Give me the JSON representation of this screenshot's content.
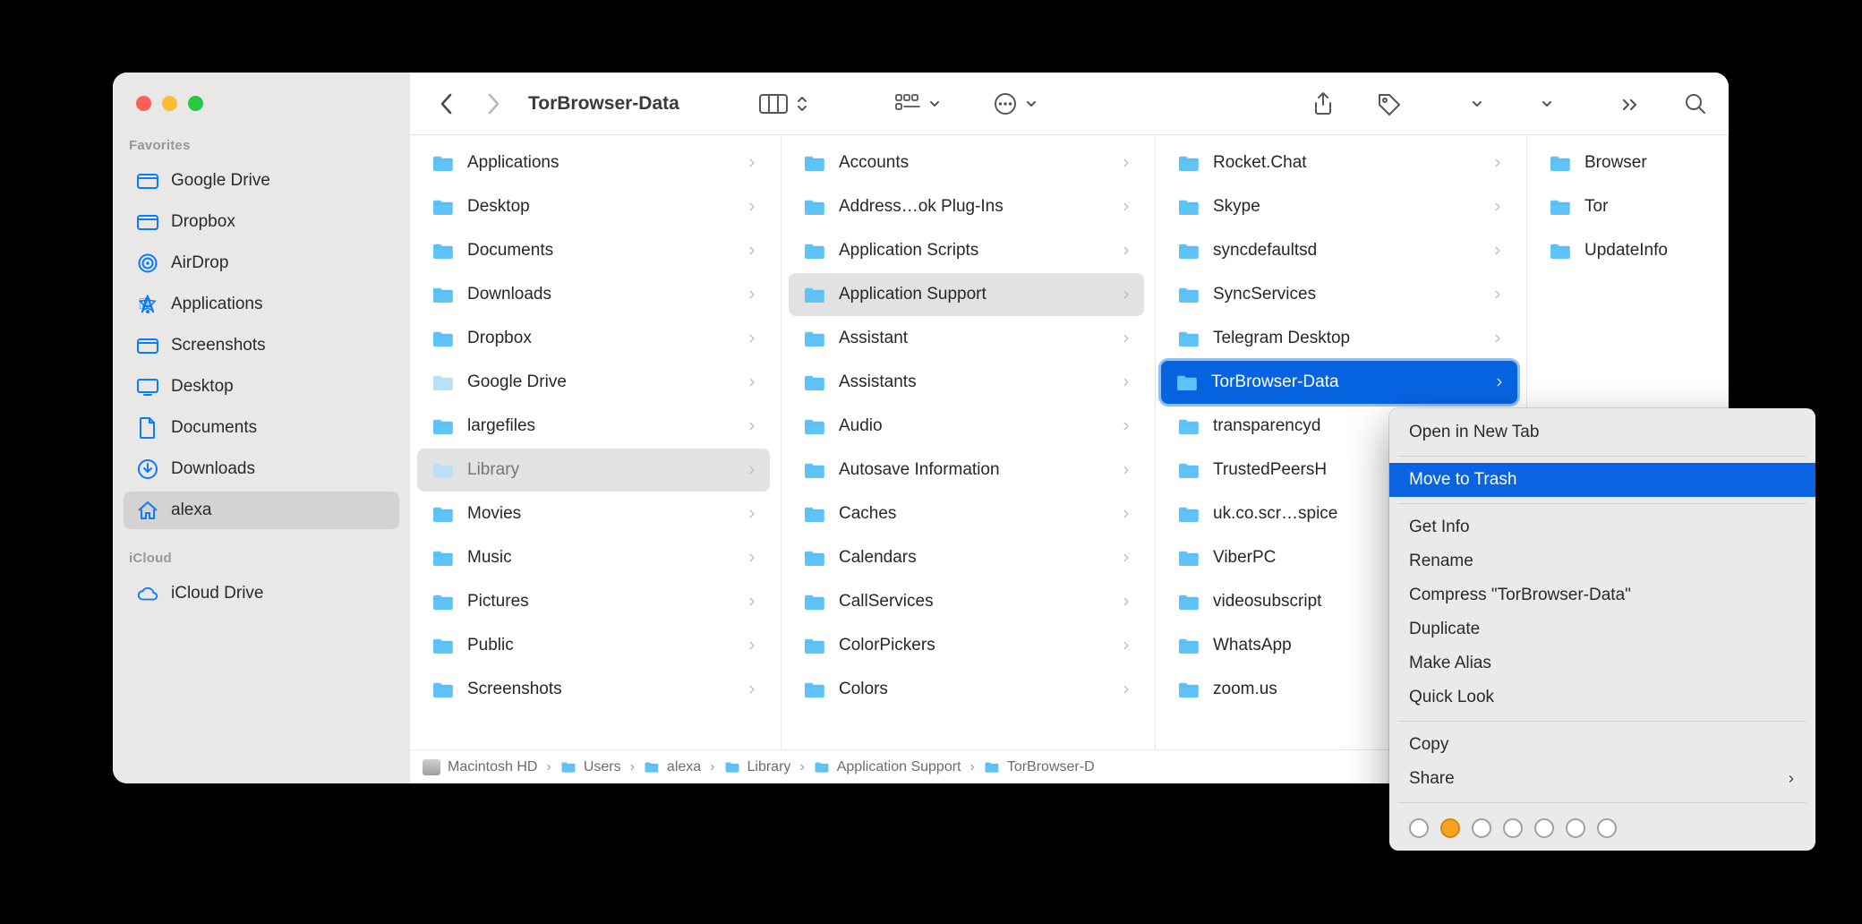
{
  "window_title": "TorBrowser-Data",
  "sidebar": {
    "sections": [
      {
        "heading": "Favorites",
        "items": [
          {
            "icon": "folder",
            "label": "Google Drive"
          },
          {
            "icon": "folder",
            "label": "Dropbox"
          },
          {
            "icon": "airdrop",
            "label": "AirDrop"
          },
          {
            "icon": "apps",
            "label": "Applications"
          },
          {
            "icon": "folder",
            "label": "Screenshots"
          },
          {
            "icon": "desktop",
            "label": "Desktop"
          },
          {
            "icon": "document",
            "label": "Documents"
          },
          {
            "icon": "download",
            "label": "Downloads"
          },
          {
            "icon": "home",
            "label": "alexa",
            "active": true
          }
        ]
      },
      {
        "heading": "iCloud",
        "items": [
          {
            "icon": "cloud",
            "label": "iCloud Drive"
          }
        ]
      }
    ]
  },
  "columns": [
    {
      "items": [
        {
          "name": "Applications",
          "chev": true
        },
        {
          "name": "Desktop",
          "chev": true
        },
        {
          "name": "Documents",
          "chev": true
        },
        {
          "name": "Downloads",
          "chev": true
        },
        {
          "name": "Dropbox",
          "chev": true
        },
        {
          "name": "Google Drive",
          "chev": true,
          "tint": "light"
        },
        {
          "name": "largefiles",
          "chev": true
        },
        {
          "name": "Library",
          "chev": true,
          "sel": "gray",
          "tint": "dim"
        },
        {
          "name": "Movies",
          "chev": true
        },
        {
          "name": "Music",
          "chev": true
        },
        {
          "name": "Pictures",
          "chev": true
        },
        {
          "name": "Public",
          "chev": true
        },
        {
          "name": "Screenshots",
          "chev": true
        }
      ]
    },
    {
      "items": [
        {
          "name": "Accounts",
          "chev": true
        },
        {
          "name": "Address…ok Plug-Ins",
          "chev": true
        },
        {
          "name": "Application Scripts",
          "chev": true
        },
        {
          "name": "Application Support",
          "chev": true,
          "sel": "gray2"
        },
        {
          "name": "Assistant",
          "chev": true
        },
        {
          "name": "Assistants",
          "chev": true
        },
        {
          "name": "Audio",
          "chev": true
        },
        {
          "name": "Autosave Information",
          "chev": true
        },
        {
          "name": "Caches",
          "chev": true
        },
        {
          "name": "Calendars",
          "chev": true
        },
        {
          "name": "CallServices",
          "chev": true
        },
        {
          "name": "ColorPickers",
          "chev": true
        },
        {
          "name": "Colors",
          "chev": true
        }
      ]
    },
    {
      "items": [
        {
          "name": "Rocket.Chat",
          "chev": true
        },
        {
          "name": "Skype",
          "chev": true
        },
        {
          "name": "syncdefaultsd",
          "chev": true
        },
        {
          "name": "SyncServices",
          "chev": true
        },
        {
          "name": "Telegram Desktop",
          "chev": true
        },
        {
          "name": "TorBrowser-Data",
          "chev": true,
          "sel": "blue"
        },
        {
          "name": "transparencyd",
          "chev": true
        },
        {
          "name": "TrustedPeersH",
          "chev": true
        },
        {
          "name": "uk.co.scr…spice",
          "chev": true
        },
        {
          "name": "ViberPC",
          "chev": true
        },
        {
          "name": "videosubscript",
          "chev": true
        },
        {
          "name": "WhatsApp",
          "chev": true
        },
        {
          "name": "zoom.us",
          "chev": true
        }
      ]
    },
    {
      "items": [
        {
          "name": "Browser",
          "chev": false
        },
        {
          "name": "Tor",
          "chev": false
        },
        {
          "name": "UpdateInfo",
          "chev": false
        }
      ]
    }
  ],
  "pathbar": [
    {
      "icon": "disk",
      "label": "Macintosh HD"
    },
    {
      "icon": "folder",
      "label": "Users"
    },
    {
      "icon": "home",
      "label": "alexa"
    },
    {
      "icon": "folder",
      "label": "Library"
    },
    {
      "icon": "folder",
      "label": "Application Support"
    },
    {
      "icon": "folder",
      "label": "TorBrowser-D"
    }
  ],
  "context_menu": {
    "groups": [
      [
        {
          "label": "Open in New Tab"
        }
      ],
      [
        {
          "label": "Move to Trash",
          "highlight": true
        }
      ],
      [
        {
          "label": "Get Info"
        },
        {
          "label": "Rename"
        },
        {
          "label": "Compress \"TorBrowser-Data\""
        },
        {
          "label": "Duplicate"
        },
        {
          "label": "Make Alias"
        },
        {
          "label": "Quick Look"
        }
      ],
      [
        {
          "label": "Copy"
        },
        {
          "label": "Share",
          "submenu": true
        }
      ]
    ],
    "tags": [
      "none",
      "orange",
      "none",
      "none",
      "none",
      "none",
      "none"
    ]
  }
}
